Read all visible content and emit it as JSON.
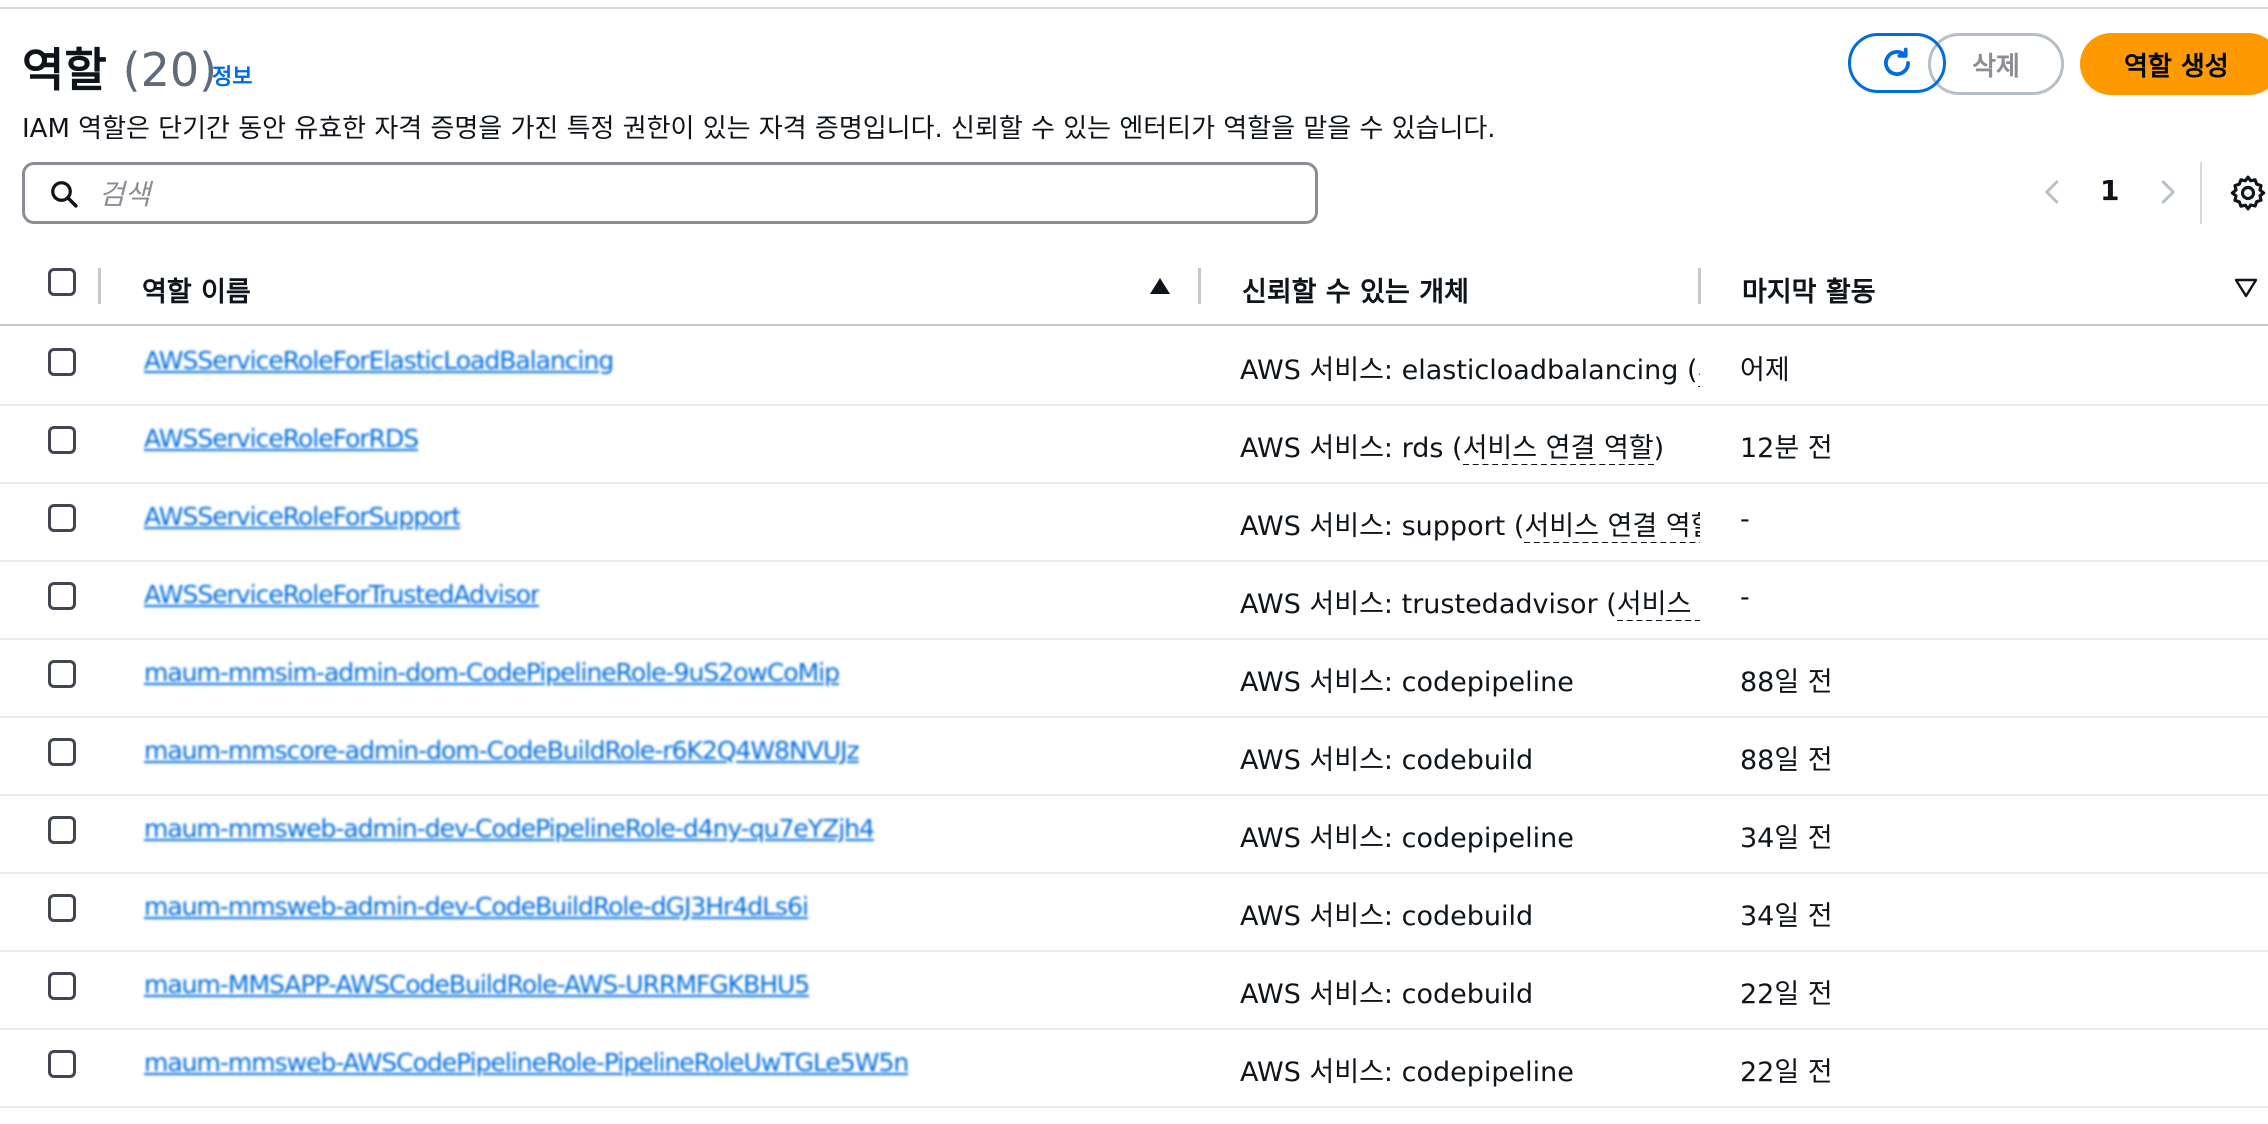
{
  "header": {
    "title": "역할",
    "count": "(20)",
    "info_link": "정보",
    "description": "IAM 역할은 단기간 동안 유효한 자격 증명을 가진 특정 권한이 있는 자격 증명입니다. 신뢰할 수 있는 엔터티가 역할을 맡을 수 있습니다."
  },
  "actions": {
    "refresh_icon": "refresh-icon",
    "delete_label": "삭제",
    "create_label": "역할 생성"
  },
  "search": {
    "placeholder": "검색",
    "value": ""
  },
  "pagination": {
    "current_page": "1"
  },
  "colors": {
    "link": "#006ce0",
    "primary_button": "#ff9900",
    "border": "#8c8c94"
  },
  "table": {
    "columns": {
      "role_name": "역할 이름",
      "trusted_entity": "신뢰할 수 있는 개체",
      "last_activity": "마지막 활동"
    },
    "sort": "ascending",
    "rows": [
      {
        "role_name": "AWSServiceRoleForElasticLoadBalancing",
        "trusted_prefix": "AWS 서비스: elasticloadbalancing",
        "trusted_suffix": "서비스 연결 역할",
        "last_activity": "어제"
      },
      {
        "role_name": "AWSServiceRoleForRDS",
        "trusted_prefix": "AWS 서비스: rds",
        "trusted_suffix": "서비스 연결 역할",
        "last_activity": "12분 전"
      },
      {
        "role_name": "AWSServiceRoleForSupport",
        "trusted_prefix": "AWS 서비스: support",
        "trusted_suffix": "서비스 연결 역할",
        "last_activity": "-"
      },
      {
        "role_name": "AWSServiceRoleForTrustedAdvisor",
        "trusted_prefix": "AWS 서비스: trustedadvisor",
        "trusted_suffix": "서비스 연결 역할",
        "last_activity": "-"
      },
      {
        "role_name": "maum-mmsim-admin-dom-CodePipelineRole-9uS2owCoMip",
        "trusted_prefix": "AWS 서비스: codepipeline",
        "trusted_suffix": "",
        "last_activity": "88일 전"
      },
      {
        "role_name": "maum-mmscore-admin-dom-CodeBuildRole-r6K2Q4W8NVUJz",
        "trusted_prefix": "AWS 서비스: codebuild",
        "trusted_suffix": "",
        "last_activity": "88일 전"
      },
      {
        "role_name": "maum-mmsweb-admin-dev-CodePipelineRole-d4ny-qu7eYZjh4",
        "trusted_prefix": "AWS 서비스: codepipeline",
        "trusted_suffix": "",
        "last_activity": "34일 전"
      },
      {
        "role_name": "maum-mmsweb-admin-dev-CodeBuildRole-dGJ3Hr4dLs6i",
        "trusted_prefix": "AWS 서비스: codebuild",
        "trusted_suffix": "",
        "last_activity": "34일 전"
      },
      {
        "role_name": "maum-MMSAPP-AWSCodeBuildRole-AWS-URRMFGKBHU5",
        "trusted_prefix": "AWS 서비스: codebuild",
        "trusted_suffix": "",
        "last_activity": "22일 전"
      },
      {
        "role_name": "maum-mmsweb-AWSCodePipelineRole-PipelineRoleUwTGLe5W5n",
        "trusted_prefix": "AWS 서비스: codepipeline",
        "trusted_suffix": "",
        "last_activity": "22일 전"
      }
    ]
  }
}
